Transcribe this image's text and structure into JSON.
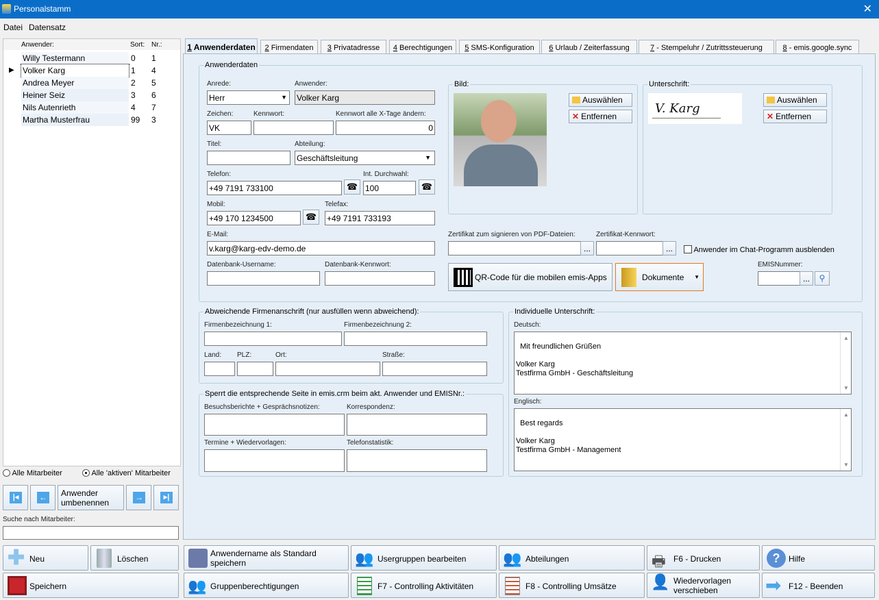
{
  "window": {
    "title": "Personalstamm",
    "close": "✕"
  },
  "menu": [
    "Datei",
    "Datensatz"
  ],
  "list": {
    "headers": {
      "user": "Anwender:",
      "sort": "Sort:",
      "nr": "Nr.:"
    },
    "rows": [
      {
        "name": "Willy Testermann",
        "sort": "0",
        "nr": "1"
      },
      {
        "name": "Volker Karg",
        "sort": "1",
        "nr": "4"
      },
      {
        "name": "Andrea Meyer",
        "sort": "2",
        "nr": "5"
      },
      {
        "name": "Heiner Seiz",
        "sort": "3",
        "nr": "6"
      },
      {
        "name": "Nils Autenrieth",
        "sort": "4",
        "nr": "7"
      },
      {
        "name": "Martha Musterfrau",
        "sort": "99",
        "nr": "3"
      }
    ],
    "selected_index": 1
  },
  "filter": {
    "all": "Alle Mitarbeiter",
    "active": "Alle 'aktiven' Mitarbeiter",
    "selected": "active"
  },
  "nav": {
    "rename": "Anwender umbenennen"
  },
  "search": {
    "label": "Suche nach Mitarbeiter:",
    "value": ""
  },
  "tabs": [
    {
      "key": "1",
      "label": " Anwenderdaten"
    },
    {
      "key": "2",
      "label": " Firmendaten"
    },
    {
      "key": "3",
      "label": " Privatadresse"
    },
    {
      "key": "4",
      "label": " Berechtigungen"
    },
    {
      "key": "5",
      "label": " SMS-Konfiguration"
    },
    {
      "key": "6",
      "label": " Urlaub / Zeiterfassung"
    },
    {
      "key": "7",
      "label": " - Stempeluhr / Zutrittssteuerung"
    },
    {
      "key": "8",
      "label": " - emis.google.sync"
    }
  ],
  "userdata": {
    "group": "Anwenderdaten",
    "anrede": {
      "label": "Anrede:",
      "value": "Herr"
    },
    "anwender": {
      "label": "Anwender:",
      "value": "Volker Karg"
    },
    "zeichen": {
      "label": "Zeichen:",
      "value": "VK"
    },
    "kennwort": {
      "label": "Kennwort:",
      "value": ""
    },
    "kennwort_tage": {
      "label": "Kennwort alle X-Tage ändern:",
      "value": "0"
    },
    "titel": {
      "label": "Titel:",
      "value": ""
    },
    "abteilung": {
      "label": "Abteilung:",
      "value": "Geschäftsleitung"
    },
    "telefon": {
      "label": "Telefon:",
      "value": "+49 7191 733100"
    },
    "durchwahl": {
      "label": "Int. Durchwahl:",
      "value": "100"
    },
    "mobil": {
      "label": "Mobil:",
      "value": "+49 170 1234500"
    },
    "telefax": {
      "label": "Telefax:",
      "value": "+49 7191 733193"
    },
    "email": {
      "label": "E-Mail:",
      "value": "v.karg@karg-edv-demo.de"
    },
    "db_user": {
      "label": "Datenbank-Username:",
      "value": ""
    },
    "db_pass": {
      "label": "Datenbank-Kennwort:",
      "value": ""
    }
  },
  "bild": {
    "label": "Bild:",
    "select": "Auswählen",
    "remove": "Entfernen"
  },
  "unterschrift": {
    "label": "Unterschrift:",
    "select": "Auswählen",
    "remove": "Entfernen",
    "sig_text": "V. Karg"
  },
  "cert": {
    "label": "Zertifikat zum signieren von PDF-Dateien:",
    "pw_label": "Zertifikat-Kennwort:",
    "browse": "...",
    "hide_chat": "Anwender im Chat-Programm ausblenden"
  },
  "qr": {
    "label": "QR-Code für die mobilen emis-Apps"
  },
  "docs": {
    "label": "Dokumente"
  },
  "emis": {
    "label": "EMISNummer:",
    "value": "",
    "browse": "..."
  },
  "company": {
    "group": "Abweichende Firmenanschrift (nur ausfüllen wenn abweichend):",
    "name1": "Firmenbezeichnung 1:",
    "name2": "Firmenbezeichnung 2:",
    "land": "Land:",
    "plz": "PLZ:",
    "ort": "Ort:",
    "strasse": "Straße:"
  },
  "block": {
    "group": "Sperrt die entsprechende Seite in emis.crm beim akt. Anwender und EMISNr.:",
    "visits": "Besuchsberichte + Gesprächsnotizen:",
    "corr": "Korrespondenz:",
    "dates": "Termine + Wiedervorlagen:",
    "phone": "Telefonstatistik:"
  },
  "signature": {
    "group": "Individuelle Unterschrift:",
    "de_label": "Deutsch:",
    "de_text": "Mit freundlichen Grüßen\n\nVolker Karg\nTestfirma GmbH - Geschäftsleitung",
    "en_label": "Englisch:",
    "en_text": "Best regards\n\nVolker Karg\nTestfirma GmbH - Management"
  },
  "footer": {
    "neu": "Neu",
    "loeschen": "Löschen",
    "standard": "Anwendername als Standard speichern",
    "usergruppen": "Usergruppen bearbeiten",
    "abteilungen": "Abteilungen",
    "drucken": "F6 - Drucken",
    "hilfe": "Hilfe",
    "speichern": "Speichern",
    "gruppen": "Gruppenberechtigungen",
    "f7": "F7 - Controlling Aktivitäten",
    "f8": "F8 - Controlling Umsätze",
    "wiedervorlagen": "Wiedervorlagen verschieben",
    "f12": "F12 - Beenden"
  },
  "colors": {
    "titlebar": "#0a6ec8",
    "panel": "#e6eff7",
    "accent_border": "#e07a20"
  }
}
